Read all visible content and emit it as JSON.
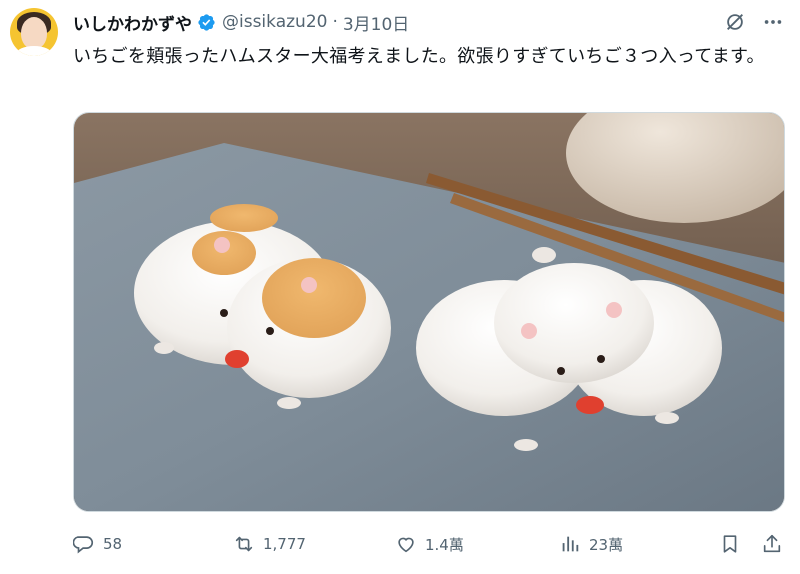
{
  "author": {
    "display_name": "いしかわかずや",
    "handle": "@issikazu20",
    "separator": "·",
    "date": "3月10日",
    "verified": true
  },
  "tweet": {
    "text": "いちごを頬張ったハムスター大福考えました。欲張りすぎていちご３つ入ってます。"
  },
  "media": {
    "subject": "hamster-daifuku-photo"
  },
  "header_icons": [
    "grok-icon",
    "more-icon"
  ],
  "actions": {
    "replies": "58",
    "retweets": "1,777",
    "likes": "1.4萬",
    "views": "23萬"
  },
  "colors": {
    "text": "#0f1419",
    "secondary": "#536471",
    "verified": "#1d9bf0",
    "avatar_bg": "#f5c431"
  }
}
